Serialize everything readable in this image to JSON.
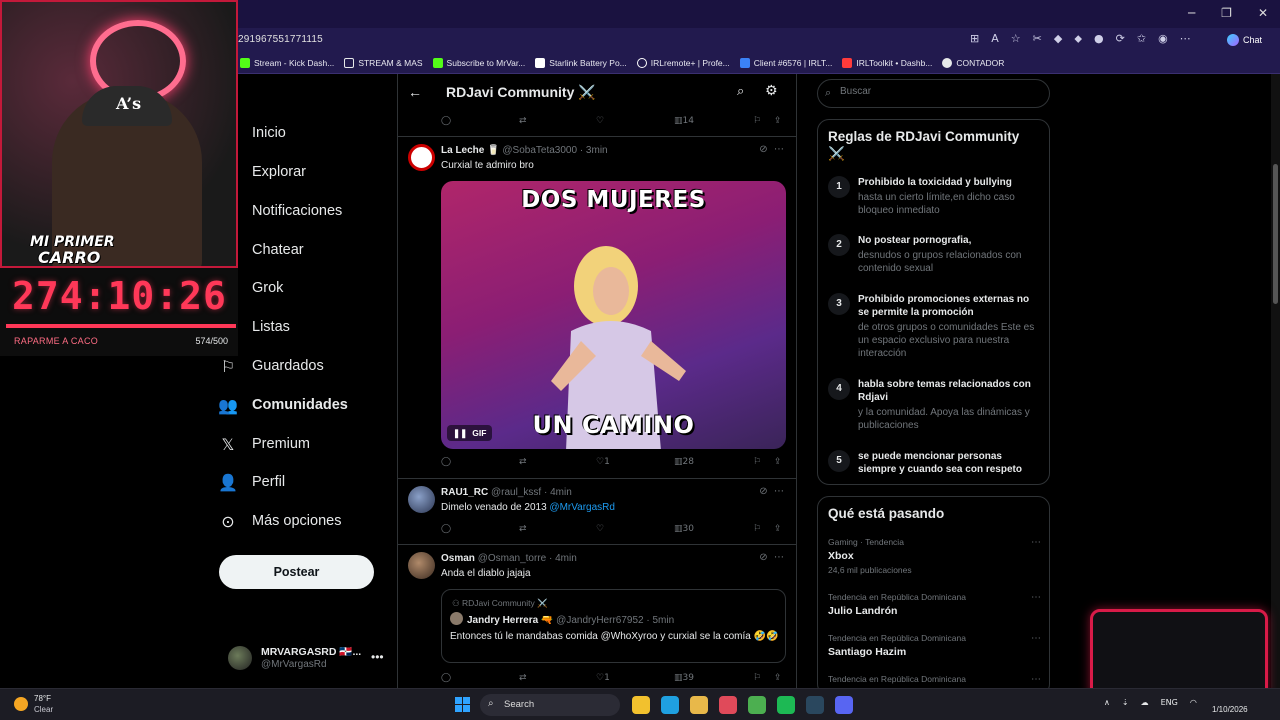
{
  "browser": {
    "url": "291967551771115",
    "chat_label": "Chat",
    "window_controls": [
      "─",
      "❐",
      "✕"
    ],
    "bookmarks": [
      {
        "label": "Stream - Kick Dash...",
        "color": "#53fc18"
      },
      {
        "label": "STREAM & MAS",
        "color": "#e7e9ea"
      },
      {
        "label": "Subscribe to MrVar...",
        "color": "#53fc18"
      },
      {
        "label": "Starlink Battery Po...",
        "color": "#ffffff"
      },
      {
        "label": "IRLremote+ | Profe...",
        "color": "#ffffff"
      },
      {
        "label": "Client #6576 | IRLT...",
        "color": "#3b82f6"
      },
      {
        "label": "IRLToolkit • Dashb...",
        "color": "#ff3b3b"
      },
      {
        "label": "CONTADOR",
        "color": "#e7e9ea"
      }
    ]
  },
  "nav": {
    "items": [
      {
        "label": "Inicio",
        "icon": "home-icon",
        "glyph": "⌂"
      },
      {
        "label": "Explorar",
        "icon": "search-icon",
        "glyph": "⌕"
      },
      {
        "label": "Notificaciones",
        "icon": "bell-icon",
        "glyph": "♫"
      },
      {
        "label": "Chatear",
        "icon": "mail-icon",
        "glyph": "✉"
      },
      {
        "label": "Grok",
        "icon": "grok-icon",
        "glyph": "⊘"
      },
      {
        "label": "Listas",
        "icon": "list-icon",
        "glyph": "☰"
      },
      {
        "label": "Guardados",
        "icon": "bookmark-icon",
        "glyph": "⚐"
      },
      {
        "label": "Comunidades",
        "icon": "communities-icon",
        "glyph": "👥"
      },
      {
        "label": "Premium",
        "icon": "x-logo-icon",
        "glyph": "𝕏"
      },
      {
        "label": "Perfil",
        "icon": "profile-icon",
        "glyph": "👤"
      },
      {
        "label": "Más opciones",
        "icon": "more-options-icon",
        "glyph": "⊙"
      }
    ],
    "post_label": "Postear",
    "account_name": "MRVARGASRD 🇩🇴...",
    "account_handle": "@MrVargasRd"
  },
  "main": {
    "title": "RDJavi Community ⚔️",
    "top_actions": {
      "views": "14"
    },
    "tweets": [
      {
        "name": "La Leche 🥛",
        "handle": "@SobaTeta3000",
        "time": "· 3min",
        "text": "Curxial te admiro bro",
        "gif": {
          "top_caption": "DOS MUJERES",
          "bottom_caption": "UN CAMINO",
          "badge": "GIF"
        },
        "likes": "1",
        "views": "28"
      },
      {
        "name": "RAU1_RC",
        "handle": "@raul_kssf",
        "time": "· 4min",
        "text": "Dimelo venado de 2013 ",
        "mention": "@MrVargasRd",
        "views": "30"
      },
      {
        "name": "Osman",
        "handle": "@Osman_torre",
        "time": "· 4min",
        "text": "Anda el diablo jajaja",
        "quote": {
          "community": "RDJavi Community ⚔️",
          "name": "Jandry Herrera 🔫",
          "handle": "@JandryHerr67952",
          "time": "· 5min",
          "text": "Entonces tú le mandabas comida @WhoXyroo y curxial se la comía 🤣🤣"
        },
        "likes": "1",
        "views": "39"
      }
    ]
  },
  "right": {
    "search_placeholder": "Buscar",
    "rules_title": "Reglas de RDJavi Community ⚔️",
    "rules": [
      {
        "num": "1",
        "title": "Prohibido la toxicidad y bullying",
        "desc": "hasta un cierto límite,en dicho caso bloqueo inmediato"
      },
      {
        "num": "2",
        "title": "No postear pornografia,",
        "desc": "desnudos o grupos relacionados con contenido sexual"
      },
      {
        "num": "3",
        "title": "Prohibido promociones externas no se permite la promoción",
        "desc": "de otros grupos o comunidades Este es un espacio exclusivo para nuestra interacción"
      },
      {
        "num": "4",
        "title": "habla sobre temas relacionados con Rdjavi",
        "desc": "y la comunidad. Apoya las dinámicas y publicaciones"
      },
      {
        "num": "5",
        "title": "se puede mencionar personas siempre y cuando sea con respeto",
        "desc": ""
      }
    ],
    "trends_title": "Qué está pasando",
    "trends": [
      {
        "context": "Gaming · Tendencia",
        "name": "Xbox",
        "posts": "24,6 mil publicaciones"
      },
      {
        "context": "Tendencia en República Dominicana",
        "name": "Julio Landrón",
        "posts": ""
      },
      {
        "context": "Tendencia en República Dominicana",
        "name": "Santiago Hazim",
        "posts": ""
      },
      {
        "context": "Tendencia en República Dominicana",
        "name": "",
        "posts": ""
      }
    ]
  },
  "stream_overlay": {
    "sticker_line1": "MI PRIMER",
    "sticker_line2": "CARRO",
    "timer": "274:10:26",
    "goal_label": "RAPARME A CACO",
    "goal_count": "574/500",
    "goal_progress": 1.0
  },
  "taskbar": {
    "temperature": "78°F",
    "condition": "Clear",
    "search_label": "Search",
    "language": "ENG",
    "date": "1/10/2026",
    "apps": [
      {
        "name": "file-explorer",
        "color": "#f2c12e"
      },
      {
        "name": "edge",
        "color": "#1fa0e0"
      },
      {
        "name": "folder",
        "color": "#e8b84a"
      },
      {
        "name": "snipping-tool",
        "color": "#e04a5a"
      },
      {
        "name": "chrome",
        "color": "#4caf50"
      },
      {
        "name": "spotify",
        "color": "#1db954"
      },
      {
        "name": "steam",
        "color": "#2a475e"
      },
      {
        "name": "discord",
        "color": "#5865f2"
      }
    ]
  },
  "colors": {
    "accent": "#1d9bf0",
    "overlay_red": "#ff3858"
  }
}
